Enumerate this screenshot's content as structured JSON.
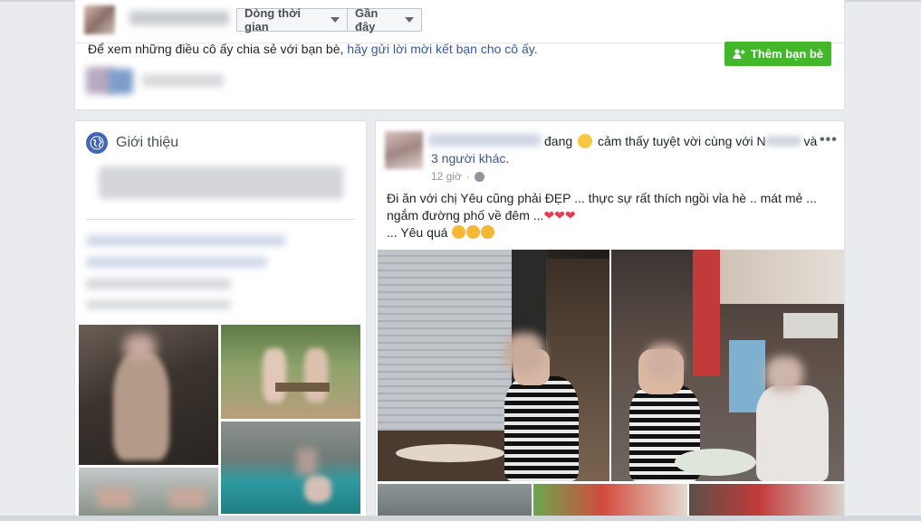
{
  "top_card": {
    "timeline_select": "Dòng thời gian",
    "recent_select": "Gần đây",
    "friend_message": "Để xem những điều cô ấy chia sẻ với bạn bè,",
    "friend_link": "hãy gửi lời mời kết bạn cho cô ấy.",
    "add_friend_label": "Thêm bạn bè"
  },
  "intro": {
    "title": "Giới thiệu"
  },
  "post": {
    "status_line": "đang",
    "feeling": "cảm thấy tuyệt vời cùng với N",
    "and": "và",
    "others_link": "3 người khác.",
    "time": "12 giờ",
    "text_line1": "Đi ăn với chị Yêu cũng phải ĐẸP ... thực sự rất thích ngồi vỉa hè .. mát mẻ ...",
    "text_line2": "ngắm đường phố về đêm ...",
    "text_line3": "... Yêu quá",
    "hearts": "❤❤❤",
    "more": "•••"
  },
  "colors": {
    "add_friend_bg": "#42b72a",
    "link": "#385898",
    "page_bg": "#e9ebee"
  }
}
